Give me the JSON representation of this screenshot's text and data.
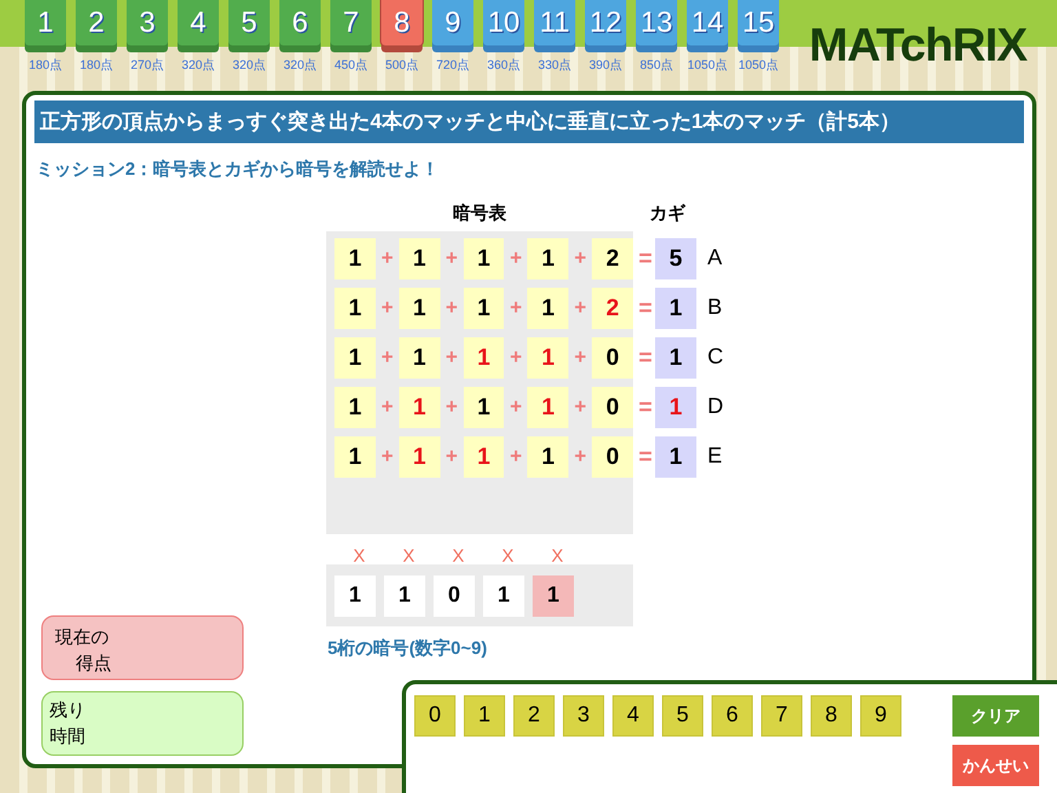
{
  "stages": [
    {
      "number": "1",
      "score": "180点",
      "kind": "cleared",
      "selected": false
    },
    {
      "number": "2",
      "score": "180点",
      "kind": "cleared",
      "selected": false
    },
    {
      "number": "3",
      "score": "270点",
      "kind": "cleared",
      "selected": false
    },
    {
      "number": "4",
      "score": "320点",
      "kind": "cleared",
      "selected": false
    },
    {
      "number": "5",
      "score": "320点",
      "kind": "cleared",
      "selected": false
    },
    {
      "number": "6",
      "score": "320点",
      "kind": "cleared",
      "selected": false
    },
    {
      "number": "7",
      "score": "450点",
      "kind": "cleared",
      "selected": false
    },
    {
      "number": "8",
      "score": "500点",
      "kind": "current",
      "selected": true
    },
    {
      "number": "9",
      "score": "720点",
      "kind": "open",
      "selected": false
    },
    {
      "number": "10",
      "score": "360点",
      "kind": "open",
      "selected": false
    },
    {
      "number": "11",
      "score": "330点",
      "kind": "open",
      "selected": false
    },
    {
      "number": "12",
      "score": "390点",
      "kind": "open",
      "selected": false
    },
    {
      "number": "13",
      "score": "850点",
      "kind": "open",
      "selected": false
    },
    {
      "number": "14",
      "score": "1050点",
      "kind": "open",
      "selected": false
    },
    {
      "number": "15",
      "score": "1050点",
      "kind": "open",
      "selected": false
    }
  ],
  "logo": "MATchRIX",
  "title": "正方形の頂点からまっすぐ突き出た4本のマッチと中心に垂直に立った1本のマッチ（計5本）",
  "mission": "ミッション2：暗号表とカギから暗号を解読せよ！",
  "table": {
    "heading": "暗号表",
    "key_heading": "カギ",
    "plus": "+",
    "equals": "=",
    "rows": [
      {
        "cells": [
          {
            "value": "1",
            "highlighted": false
          },
          {
            "value": "1",
            "highlighted": false
          },
          {
            "value": "1",
            "highlighted": false
          },
          {
            "value": "1",
            "highlighted": false
          },
          {
            "value": "2",
            "highlighted": false
          }
        ],
        "key": {
          "value": "5",
          "highlighted": false
        },
        "letter": "A"
      },
      {
        "cells": [
          {
            "value": "1",
            "highlighted": false
          },
          {
            "value": "1",
            "highlighted": false
          },
          {
            "value": "1",
            "highlighted": false
          },
          {
            "value": "1",
            "highlighted": false
          },
          {
            "value": "2",
            "highlighted": true
          }
        ],
        "key": {
          "value": "1",
          "highlighted": false
        },
        "letter": "B"
      },
      {
        "cells": [
          {
            "value": "1",
            "highlighted": false
          },
          {
            "value": "1",
            "highlighted": false
          },
          {
            "value": "1",
            "highlighted": true
          },
          {
            "value": "1",
            "highlighted": true
          },
          {
            "value": "0",
            "highlighted": false
          }
        ],
        "key": {
          "value": "1",
          "highlighted": false
        },
        "letter": "C"
      },
      {
        "cells": [
          {
            "value": "1",
            "highlighted": false
          },
          {
            "value": "1",
            "highlighted": true
          },
          {
            "value": "1",
            "highlighted": false
          },
          {
            "value": "1",
            "highlighted": true
          },
          {
            "value": "0",
            "highlighted": false
          }
        ],
        "key": {
          "value": "1",
          "highlighted": true
        },
        "letter": "D"
      },
      {
        "cells": [
          {
            "value": "1",
            "highlighted": false
          },
          {
            "value": "1",
            "highlighted": true
          },
          {
            "value": "1",
            "highlighted": true
          },
          {
            "value": "1",
            "highlighted": false
          },
          {
            "value": "0",
            "highlighted": false
          }
        ],
        "key": {
          "value": "1",
          "highlighted": false
        },
        "letter": "E"
      }
    ]
  },
  "answer": {
    "marks": [
      "X",
      "X",
      "X",
      "X",
      "X"
    ],
    "digits": [
      {
        "value": "1",
        "selected": false
      },
      {
        "value": "1",
        "selected": false
      },
      {
        "value": "0",
        "selected": false
      },
      {
        "value": "1",
        "selected": false
      },
      {
        "value": "1",
        "selected": true
      }
    ],
    "caption": "5桁の暗号(数字0~9)"
  },
  "score_label": [
    "現在の",
    "得点"
  ],
  "time_label": [
    "残り",
    "時間"
  ],
  "keypad": {
    "keys": [
      "0",
      "1",
      "2",
      "3",
      "4",
      "5",
      "6",
      "7",
      "8",
      "9"
    ],
    "clear": "クリア",
    "submit": "かんせい"
  }
}
